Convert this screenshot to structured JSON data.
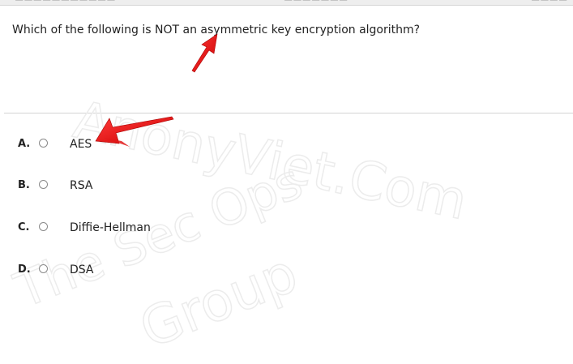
{
  "question": {
    "text": "Which of the following is NOT an asymmetric key encryption algorithm?"
  },
  "answers": [
    {
      "letter": "A.",
      "label": "AES"
    },
    {
      "letter": "B.",
      "label": "RSA"
    },
    {
      "letter": "C.",
      "label": "Diffie-Hellman"
    },
    {
      "letter": "D.",
      "label": "DSA"
    }
  ],
  "watermark": {
    "lines": [
      "AnonyViet.Com",
      "The Sec Ops",
      "Group"
    ]
  },
  "colors": {
    "annotation_arrow": "#ee1111",
    "radio_border": "#8a8a8a",
    "divider": "#d4d4d4"
  }
}
